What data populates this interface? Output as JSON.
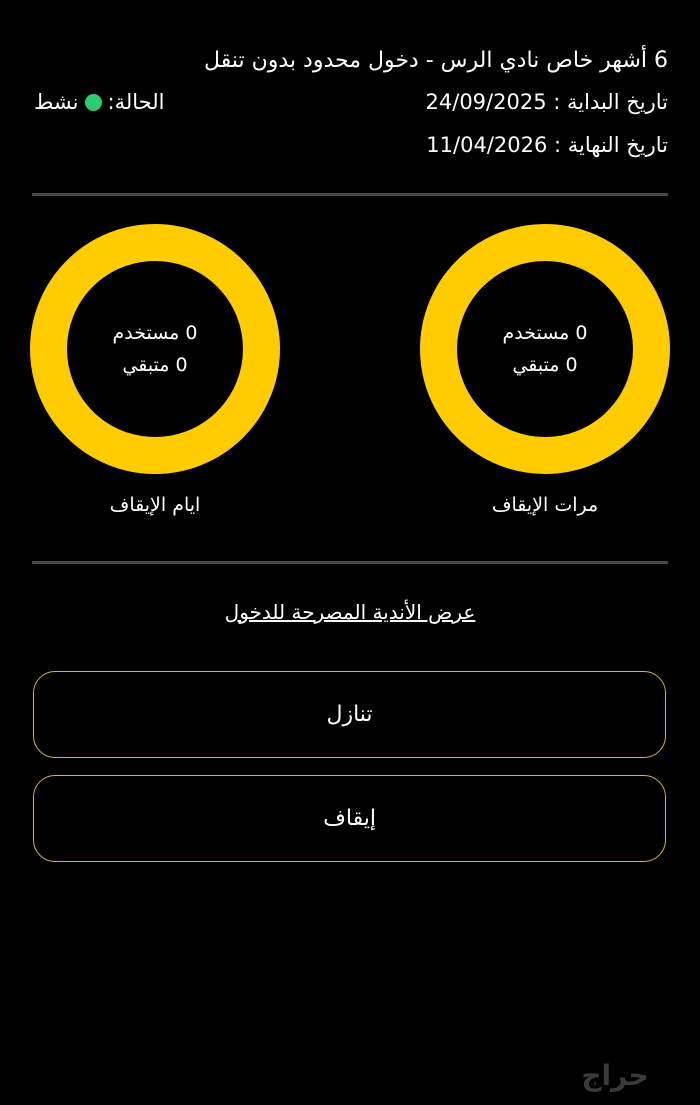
{
  "membership": {
    "title": "6 أشهر خاص نادي الرس - دخول محدود بدون تنقل",
    "start_date_label": "تاريخ البداية :",
    "start_date": "24/09/2025",
    "end_date_label": "تاريخ النهاية :",
    "end_date": "11/04/2026",
    "status_label": "الحالة:",
    "status_value": "نشط",
    "status_color": "#2ecc71"
  },
  "freeze_stats": [
    {
      "label": "مرات الإيقاف",
      "used_text": "0 مستخدم",
      "remaining_text": "0 متبقي"
    },
    {
      "label": "ايام الإيقاف",
      "used_text": "0 مستخدم",
      "remaining_text": "0 متبقي"
    }
  ],
  "ring_color": "#ffcc00",
  "clubs_link_label": "عرض الأندية المصرحة للدخول",
  "buttons": {
    "transfer_label": "تنازل",
    "freeze_label": "إيقاف"
  },
  "watermark_text": "حراج"
}
